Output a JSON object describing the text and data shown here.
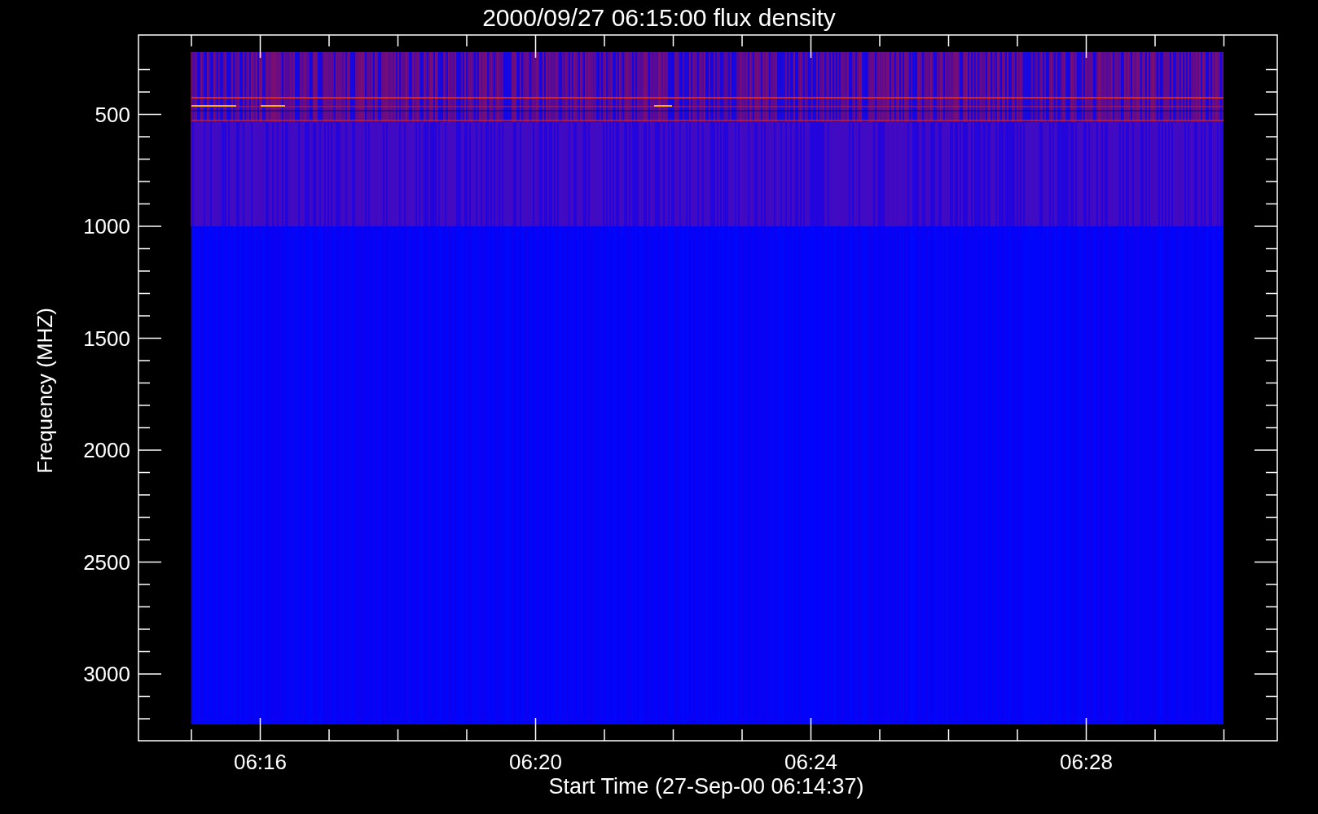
{
  "plot": {
    "title": "2000/09/27 06:15:00 flux density",
    "xlabel": "Start Time (27-Sep-00 06:14:37)",
    "ylabel": "Frequency (MHZ)",
    "x_tick_labels": [
      "06:16",
      "06:20",
      "06:24",
      "06:28"
    ],
    "y_tick_labels": [
      "500",
      "1000",
      "1500",
      "2000",
      "2500",
      "3000"
    ]
  }
}
